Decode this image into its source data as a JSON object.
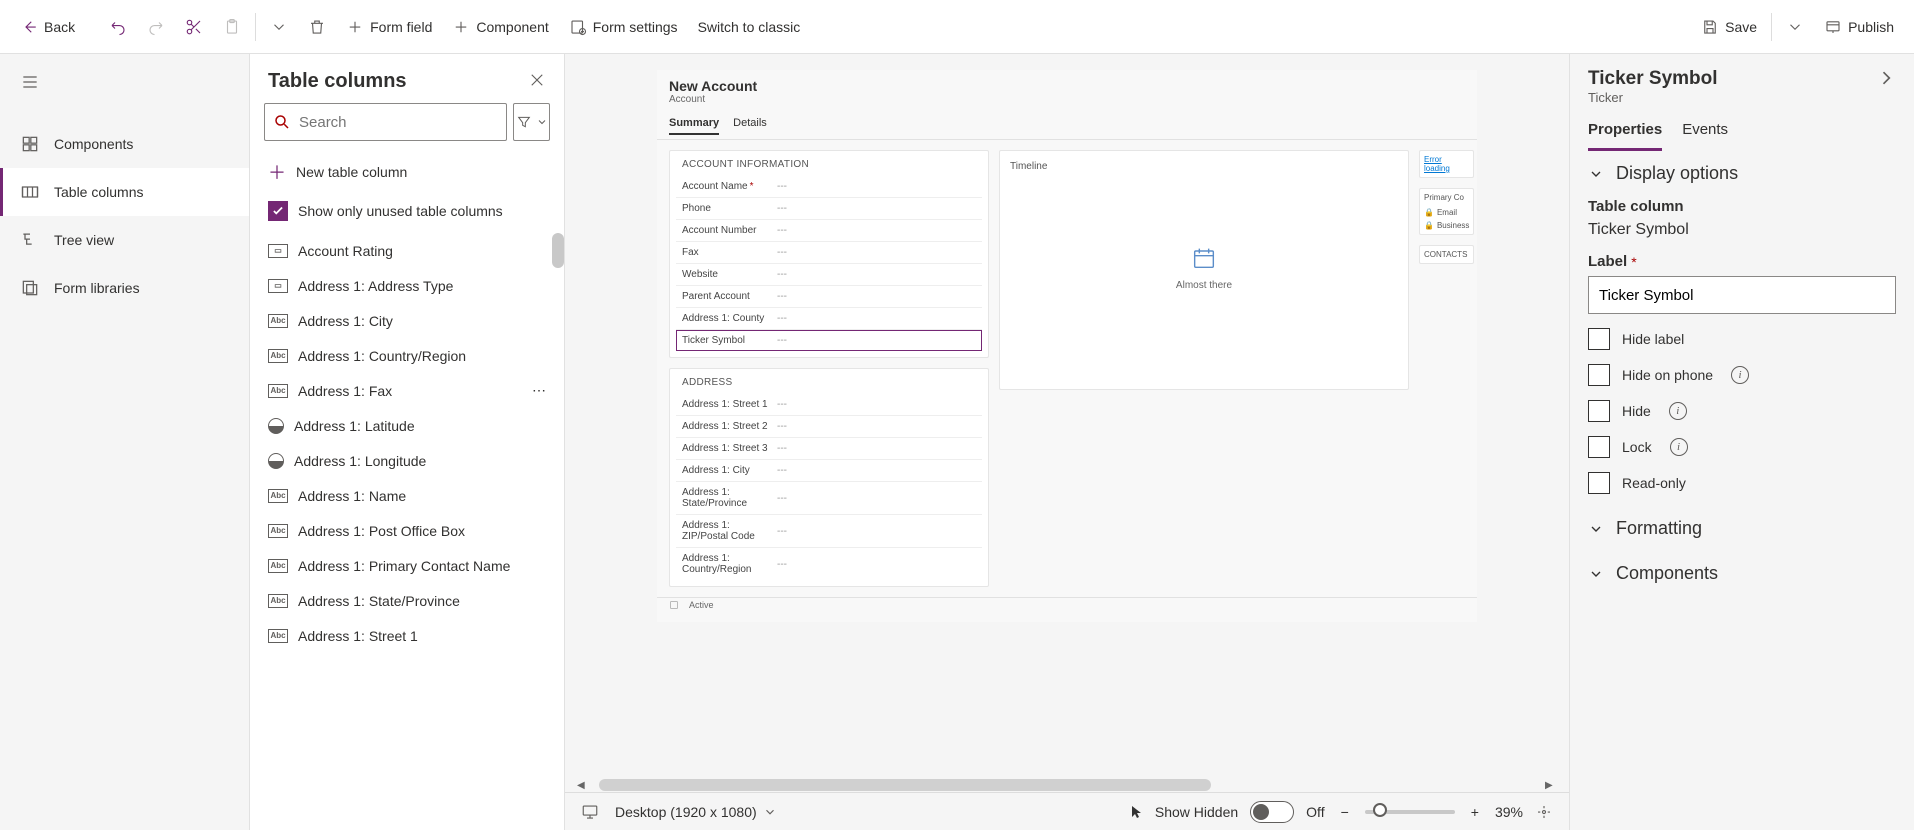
{
  "toolbar": {
    "back": "Back",
    "form_field": "Form field",
    "component": "Component",
    "form_settings": "Form settings",
    "switch_classic": "Switch to classic",
    "save": "Save",
    "publish": "Publish"
  },
  "left_rail": {
    "components": "Components",
    "table_columns": "Table columns",
    "tree_view": "Tree view",
    "form_libraries": "Form libraries"
  },
  "table_cols_panel": {
    "title": "Table columns",
    "search_placeholder": "Search",
    "new_col": "New table column",
    "show_unused": "Show only unused table columns",
    "items": [
      {
        "label": "Account Rating",
        "type": "opt"
      },
      {
        "label": "Address 1: Address Type",
        "type": "opt"
      },
      {
        "label": "Address 1: City",
        "type": "abc"
      },
      {
        "label": "Address 1: Country/Region",
        "type": "abc"
      },
      {
        "label": "Address 1: Fax",
        "type": "abc",
        "more": true
      },
      {
        "label": "Address 1: Latitude",
        "type": "circ"
      },
      {
        "label": "Address 1: Longitude",
        "type": "circ"
      },
      {
        "label": "Address 1: Name",
        "type": "abc"
      },
      {
        "label": "Address 1: Post Office Box",
        "type": "abc"
      },
      {
        "label": "Address 1: Primary Contact Name",
        "type": "abc"
      },
      {
        "label": "Address 1: State/Province",
        "type": "abc"
      },
      {
        "label": "Address 1: Street 1",
        "type": "abc"
      }
    ]
  },
  "form_preview": {
    "title": "New Account",
    "subtitle": "Account",
    "tabs": [
      {
        "label": "Summary",
        "active": true
      },
      {
        "label": "Details",
        "active": false
      }
    ],
    "sections": {
      "account_info": {
        "title": "ACCOUNT INFORMATION",
        "fields": [
          {
            "label": "Account Name",
            "required": true,
            "value": "---"
          },
          {
            "label": "Phone",
            "value": "---"
          },
          {
            "label": "Account Number",
            "value": "---"
          },
          {
            "label": "Fax",
            "value": "---"
          },
          {
            "label": "Website",
            "value": "---"
          },
          {
            "label": "Parent Account",
            "value": "---"
          },
          {
            "label": "Address 1: County",
            "value": "---"
          },
          {
            "label": "Ticker Symbol",
            "value": "---",
            "selected": true
          }
        ]
      },
      "address": {
        "title": "ADDRESS",
        "fields": [
          {
            "label": "Address 1: Street 1",
            "value": "---"
          },
          {
            "label": "Address 1: Street 2",
            "value": "---"
          },
          {
            "label": "Address 1: Street 3",
            "value": "---"
          },
          {
            "label": "Address 1: City",
            "value": "---"
          },
          {
            "label": "Address 1: State/Province",
            "value": "---"
          },
          {
            "label": "Address 1: ZIP/Postal Code",
            "value": "---"
          },
          {
            "label": "Address 1: Country/Region",
            "value": "---"
          }
        ]
      },
      "timeline": {
        "title": "Timeline",
        "status": "Almost there"
      },
      "side_cards": {
        "error": "Error loading",
        "primary": "Primary Co",
        "email": "Email",
        "business": "Business",
        "contacts": "CONTACTS"
      }
    },
    "status_bar": "Active"
  },
  "canvas_bottom": {
    "viewport": "Desktop (1920 x 1080)",
    "show_hidden": "Show Hidden",
    "toggle_state": "Off",
    "zoom": "39%"
  },
  "props_panel": {
    "title": "Ticker Symbol",
    "subtitle": "Ticker",
    "tabs": {
      "properties": "Properties",
      "events": "Events"
    },
    "display_options": "Display options",
    "table_column_label": "Table column",
    "table_column_value": "Ticker Symbol",
    "label_label": "Label",
    "label_value": "Ticker Symbol",
    "hide_label": "Hide label",
    "hide_on_phone": "Hide on phone",
    "hide": "Hide",
    "lock": "Lock",
    "read_only": "Read-only",
    "formatting": "Formatting",
    "components": "Components"
  },
  "chart_data": null
}
